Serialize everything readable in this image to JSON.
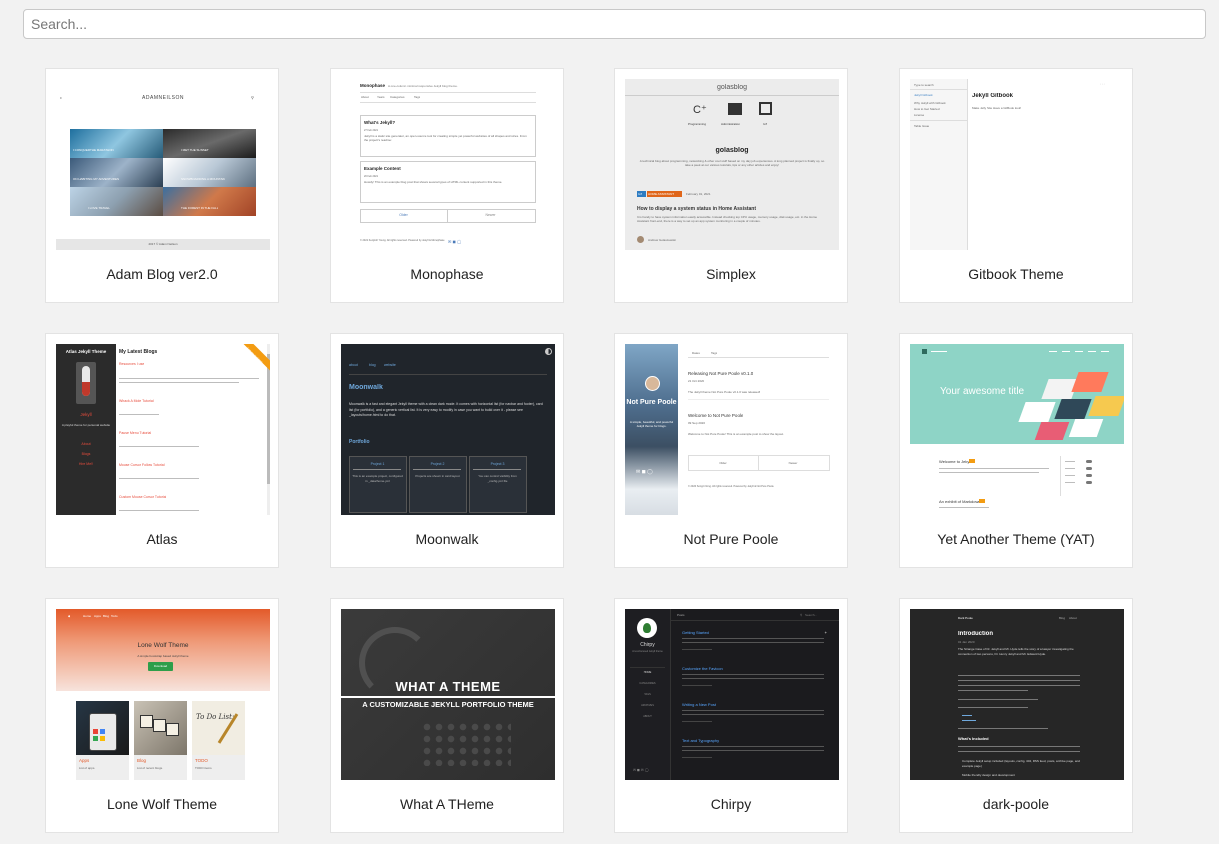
{
  "search": {
    "placeholder": "Search..."
  },
  "themes": [
    {
      "name": "Adam Blog ver2.0"
    },
    {
      "name": "Monophase"
    },
    {
      "name": "Simplex"
    },
    {
      "name": "Gitbook Theme"
    },
    {
      "name": "Atlas"
    },
    {
      "name": "Moonwalk"
    },
    {
      "name": "Not Pure Poole"
    },
    {
      "name": "Yet Another Theme (YAT)"
    },
    {
      "name": "Lone Wolf Theme"
    },
    {
      "name": "What A THeme"
    },
    {
      "name": "Chirpy"
    },
    {
      "name": "dark-poole"
    }
  ],
  "thumbs": {
    "adam": {
      "logo": "ADAMNEILSON",
      "tiles": [
        "I CONQUERTHE MARATHON",
        "I MET THE SUNSET",
        "ON HABITING MY ADVENTURES",
        "SNOWBOARDING A MOUNTAIN",
        "I LOVE TRAVEL",
        "THE FOREST IN THE FALL"
      ],
      "footer": "2017 © Adam Neilson"
    },
    "monophase": {
      "title": "Monophase",
      "tagline": "A one-column minimal responsive Jekyll blog theme.",
      "nav": [
        "About",
        "Years",
        "Categories",
        "Tags"
      ],
      "post1_title": "What's Jekyll?",
      "post1_date": "27 Feb 2021",
      "post1_text": "Jekyll is a static site generator, an open-source tool for creating simple yet powerful websites of all shapes and sizes. From the project's readme:",
      "post2_title": "Example Content",
      "post2_date": "20 Feb 2021",
      "post2_text": "Howdy! This is an example blog post that shows several types of HTML content supported in this theme.",
      "older": "Older",
      "newer": "Newer",
      "footer": "© 2021 Kenjiroh Young. All rights reserved. Powered by Jekyll & Monophase"
    },
    "simplex": {
      "title": "golasblog",
      "icons": [
        "Programming",
        "Administration",
        "IoT"
      ],
      "heading": "golasblog",
      "desc": "A technical blog about programming, networking & other cool stuff based on my day job experiences. A long planned project is finally up, so take a peek at our various tutorials, tips or any other articles and enjoy!",
      "tag1": "IoT",
      "tag2": "HOME ASSISTANT",
      "date": "February 01, 2021",
      "post_title": "How to display a system status in Home Assistant",
      "post_text": "It is handy to have system information easily accessible. Instead checking top CPU usage, memory usage, disk usage, etc. in the Home Assistant front-end, there is a way to set up an app system monitoring in a couple of minutes.",
      "author": "Andrew Golaszewski"
    },
    "gitbook": {
      "search": "Type to search",
      "side_items": [
        "Jekyll Gitbook",
        "Why Jekyll with Gitbook",
        "How to Get Started",
        "License",
        "Table Issue"
      ],
      "heading": "Jekyll Gitbook",
      "text": "Make Jelly Site Have a GitBook look!"
    },
    "atlas": {
      "title": "Atlas Jekyll Theme",
      "subtitle": "Jekyll",
      "desc": "A playful theme for personal website",
      "links": [
        "About",
        "Blogs",
        "Hire Me!!"
      ],
      "heading": "My Latest Blogs",
      "posts": [
        "Resources I use",
        "Whack A Mole Tutorial",
        "Pause Menu Tutorial",
        "Mouse Cursor Follow Tutorial",
        "Custom Mouse Cursor Tutorial"
      ],
      "ribbon": "Fork me on GitHub"
    },
    "moonwalk": {
      "nav": [
        "about",
        "blog",
        "website"
      ],
      "heading": "Moonwalk",
      "desc": "Moonwalk is a fast and elegant Jekyll theme with a clean dark mode. It comes with horizontal list (for navbar and footer), card list (for portfolio), and a generic vertical list. It is very easy to modify in case you want to build over it - please see _layouts/home.html to do that.",
      "portfolio": "Portfolio",
      "projects": [
        {
          "title": "Project 1",
          "text": "This is an example project, configured in _data/home.yml"
        },
        {
          "title": "Project 2",
          "text": "Projects are shown in card layout"
        },
        {
          "title": "Project 3",
          "text": "You can control visibility from _config.yml file"
        }
      ]
    },
    "notpoole": {
      "tabs": [
        "Dates",
        "Tags"
      ],
      "title": "Not Pure Poole",
      "side_text": "A simple, beautiful, and powerful Jekyll theme for blogs.",
      "post1_title": "Releasing Not Pure Poole v0.1.0",
      "post1_date": "21 Oct 2020",
      "post1_text": "The Jekyll theme Not Pure Poole v0.1.0 was released!",
      "post2_title": "Welcome to Not Pure Poole",
      "post2_date": "09 Sep 2020",
      "post2_text": "Welcome to Not Pure Poole! This is an example post to show the layout.",
      "older": "Older",
      "newer": "Newer",
      "footer": "© 2020 Songzi Vong. All rights reserved. Powered by Jekyll & Not Pure Poole."
    },
    "yat": {
      "hero": "Your awesome title",
      "post1": "Welcome to Jekyll!",
      "post2": "An exhibit of Markdown"
    },
    "lonewolf": {
      "nav": [
        "Home",
        "Apps",
        "Blog",
        "Todo"
      ],
      "title": "Lone Wolf Theme",
      "subtitle": "A simple bootstrap based Jekyll theme",
      "download": "Download",
      "cards": [
        {
          "title": "Apps",
          "text": "List of apps."
        },
        {
          "title": "Blog",
          "text": "List of recent blogs."
        },
        {
          "title": "TODO",
          "text": "TODO items."
        }
      ],
      "img_text": "To Do List:"
    },
    "whatatheme": {
      "title": "WHAT A THEME",
      "subtitle": "A CUSTOMIZABLE JEKYLL PORTFOLIO THEME"
    },
    "chirpy": {
      "name": "Chirpy",
      "tagline": "A text-focused Jekyll theme",
      "nav": [
        "HOME",
        "CATEGORIES",
        "TAGS",
        "ARCHIVES",
        "ABOUT"
      ],
      "topbar": "Posts",
      "search": "Search...",
      "posts": [
        "Getting Started",
        "Customize the Favicon",
        "Writing a New Post",
        "Text and Typography"
      ]
    },
    "darkpoole": {
      "brand": "Dark Poole",
      "nav": [
        "Blog",
        "About"
      ],
      "heading": "Introduction",
      "date": "01 Jan 2020",
      "para": "The Strange Case of Dr. Jekyll and Mr. Hyde tells the story of a lawyer investigating the connection of two persons, Dr. Henry Jekyll and Mr. Edward Hyde.",
      "section": "What's Included",
      "list": [
        "Complete Jekyll setup included (layouts, config, 404, RSS feed, posts, archive page, and example page)",
        "Mobile friendly design and development"
      ]
    }
  }
}
